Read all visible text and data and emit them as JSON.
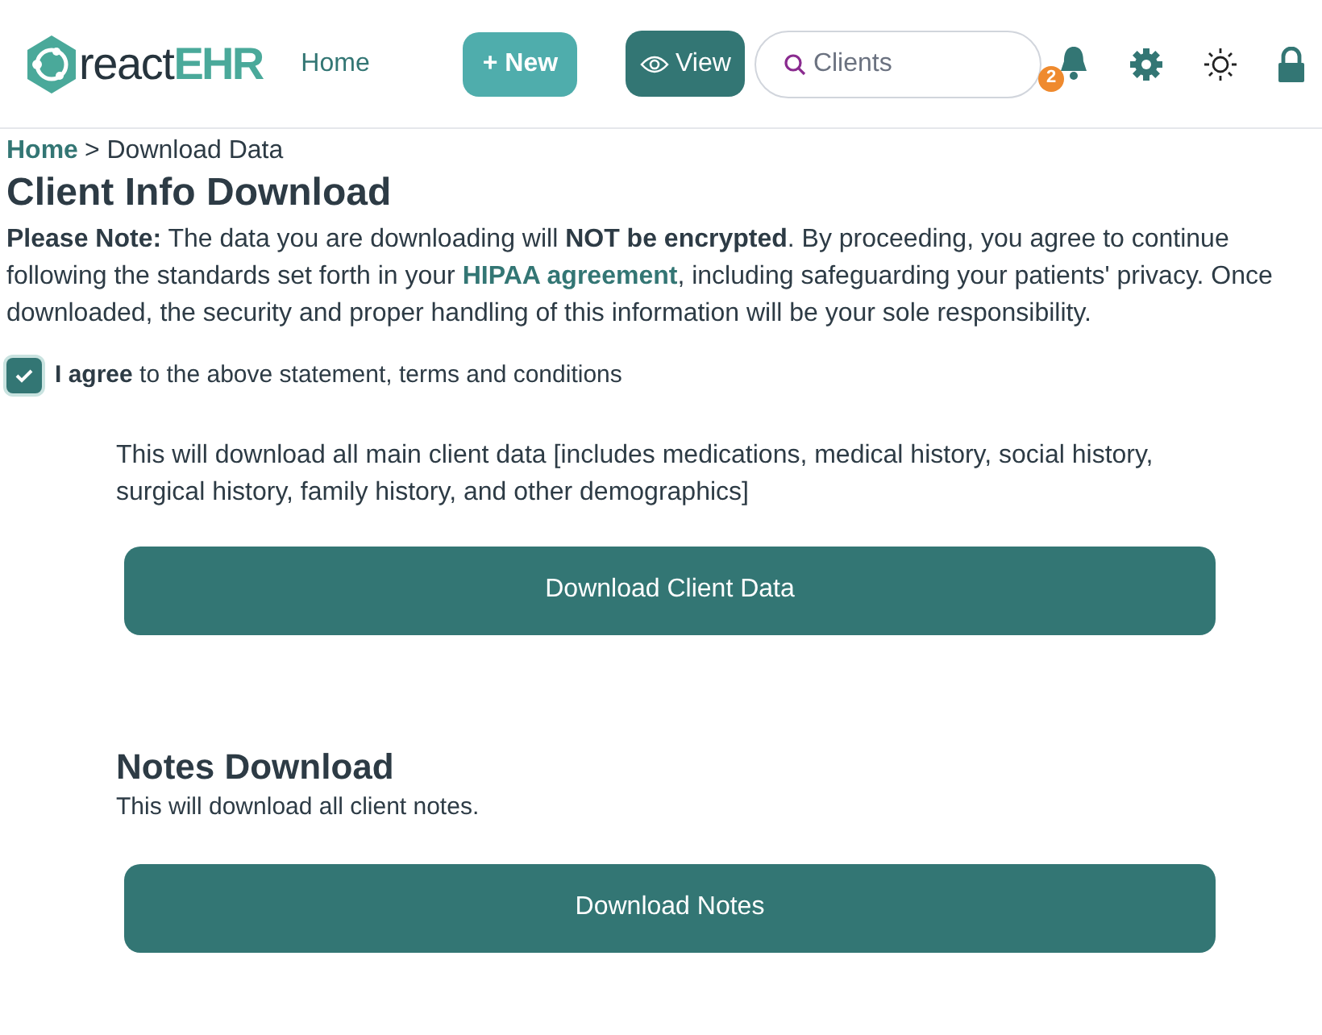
{
  "header": {
    "logo": {
      "part_1": "react",
      "part_2": "EHR"
    },
    "nav": [
      {
        "kind": "link",
        "label": "Home"
      },
      {
        "kind": "new",
        "label": "+ New"
      },
      {
        "kind": "view",
        "label": "View"
      }
    ],
    "search": {
      "placeholder": "Clients"
    },
    "notifications": {
      "count": "2"
    }
  },
  "breadcrumb": [
    {
      "label": "Home",
      "kind": "link"
    },
    {
      "label": "> Download Data",
      "kind": "current"
    }
  ],
  "title": "Client Info Download",
  "notice": {
    "before": "**Please Note:** The data you are downloading will **NOT be encrypted**. By proceeding, you agree to continue following the standards set forth in your",
    "link": "HIPAA agreement",
    "after": ", including safeguarding your patients' privacy. Once downloaded, the security and proper handling of this information will be your sole responsibility."
  },
  "agree": {
    "label": "**I agree** to the above statement, terms and conditions",
    "checked": true
  },
  "sections": [
    {
      "description": "This will download all main client data [includes medications, medical history, social history, surgical history, family history, and other demographics]",
      "button": "Download Client Data"
    },
    {
      "title": "Notes Download",
      "description": "This will download all client notes.",
      "button": "Download Notes"
    }
  ]
}
